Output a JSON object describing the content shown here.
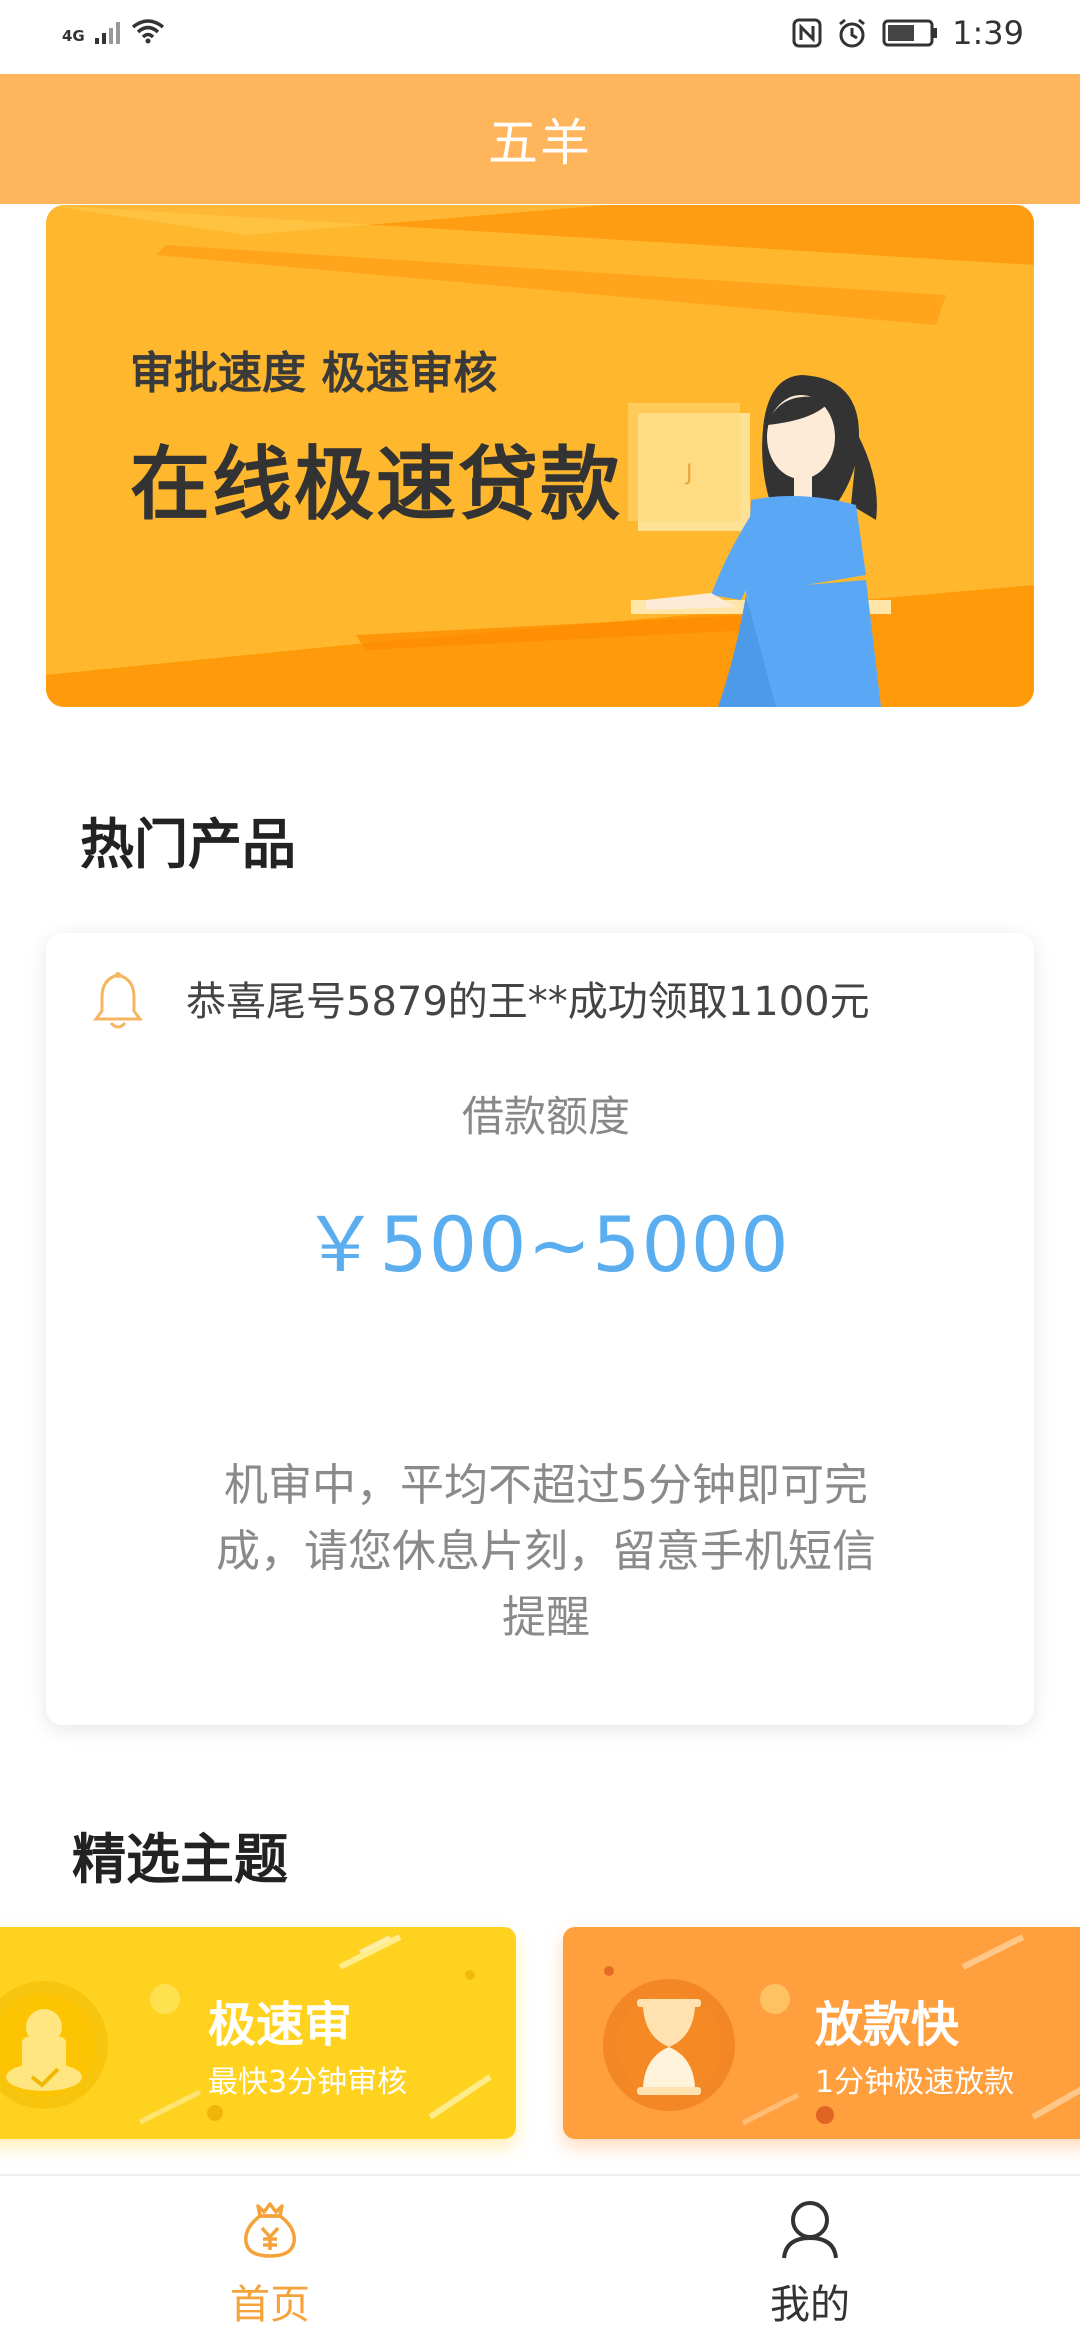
{
  "status_bar": {
    "network": "4G",
    "time": "1:39"
  },
  "header": {
    "title": "五羊"
  },
  "banner": {
    "subtitle": "审批速度 极速审核",
    "headline": "在线极速贷款",
    "colors": {
      "background": "#ffb82e",
      "accent": "#ff9a0a",
      "dress": "#5aa8f5"
    }
  },
  "hot_products": {
    "title": "热门产品",
    "notice": "恭喜尾号5879的王**成功领取1100元",
    "amount_label": "借款额度",
    "amount_range": "￥500~5000",
    "message": "机审中，平均不超过5分钟即可完成，请您休息片刻，留意手机短信提醒"
  },
  "topics": {
    "title": "精选主题",
    "items": [
      {
        "title": "极速审",
        "subtitle": "最快3分钟审核",
        "color": "#ffd21f",
        "icon": "stamp-icon"
      },
      {
        "title": "放款快",
        "subtitle": "1分钟极速放款",
        "color": "#ff9f3e",
        "icon": "hourglass-icon"
      }
    ]
  },
  "bottom_nav": {
    "items": [
      {
        "label": "首页",
        "icon": "money-bag-icon",
        "active": true,
        "color": "#f6a23a"
      },
      {
        "label": "我的",
        "icon": "user-icon",
        "active": false,
        "color": "#333333"
      }
    ]
  }
}
